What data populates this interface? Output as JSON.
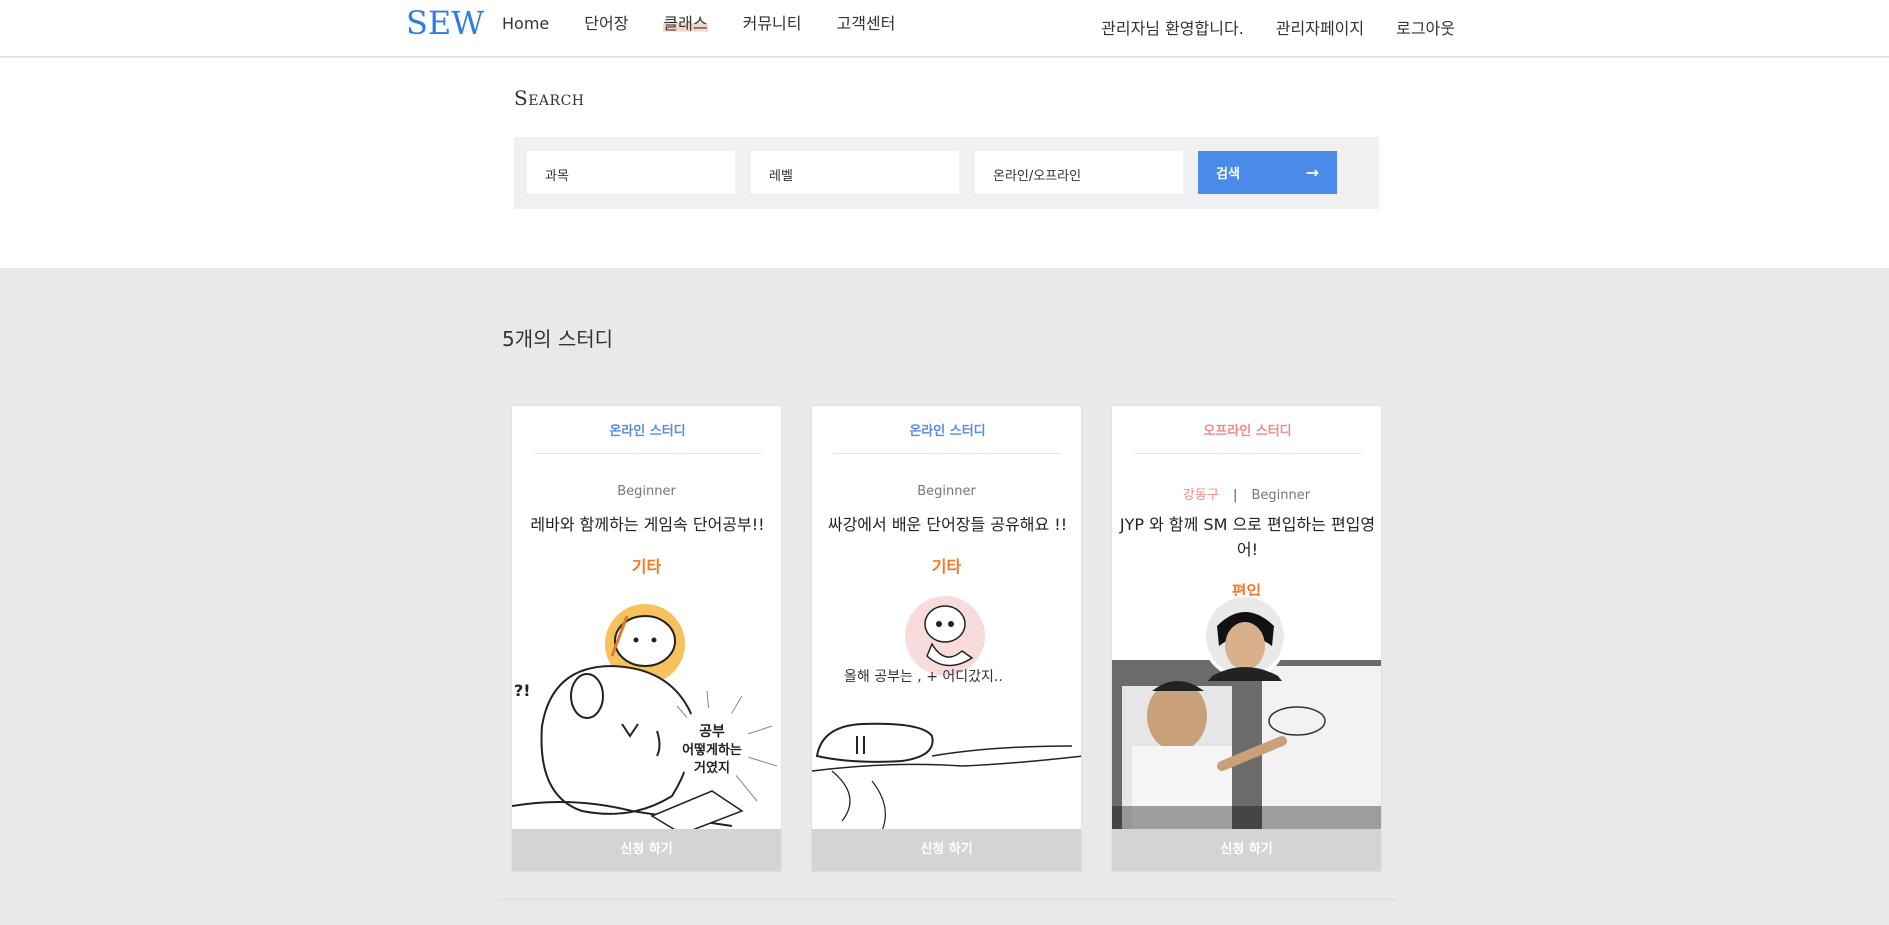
{
  "header": {
    "logo": "SEW",
    "nav": [
      "Home",
      "단어장",
      "클래스",
      "커뮤니티",
      "고객센터"
    ],
    "active_nav": "클래스",
    "welcome": "관리자님 환영합니다.",
    "admin_page": "관리자페이지",
    "logout": "로그아웃"
  },
  "search": {
    "title": "Search",
    "subject": "과목",
    "level": "레벨",
    "mode": "온라인/오프라인",
    "button": "검색"
  },
  "results": {
    "count_text": "5개의 스터디"
  },
  "cards": [
    {
      "type": "온라인 스터디",
      "level": "Beginner",
      "title": "레바와 함께하는 게임속 단어공부!!",
      "category": "기타",
      "apply": "신청 하기"
    },
    {
      "type": "온라인 스터디",
      "level": "Beginner",
      "title": "싸강에서 배운 단어장들 공유해요 !!",
      "category": "기타",
      "image_caption": "올해 공부는 , + 어디갔지..",
      "apply": "신청 하기"
    },
    {
      "type": "오프라인 스터디",
      "district": "강동구",
      "separator": "|",
      "level": "Beginner",
      "title": "JYP 와 함께 SM 으로 편입하는 편입영어!",
      "category": "편입",
      "apply": "신청 하기"
    }
  ],
  "colors": {
    "brand": "#2f7de1",
    "search_button": "#4a8ae8",
    "online": "#5b8be0",
    "offline": "#f08a8a",
    "category": "#f07a2a"
  }
}
